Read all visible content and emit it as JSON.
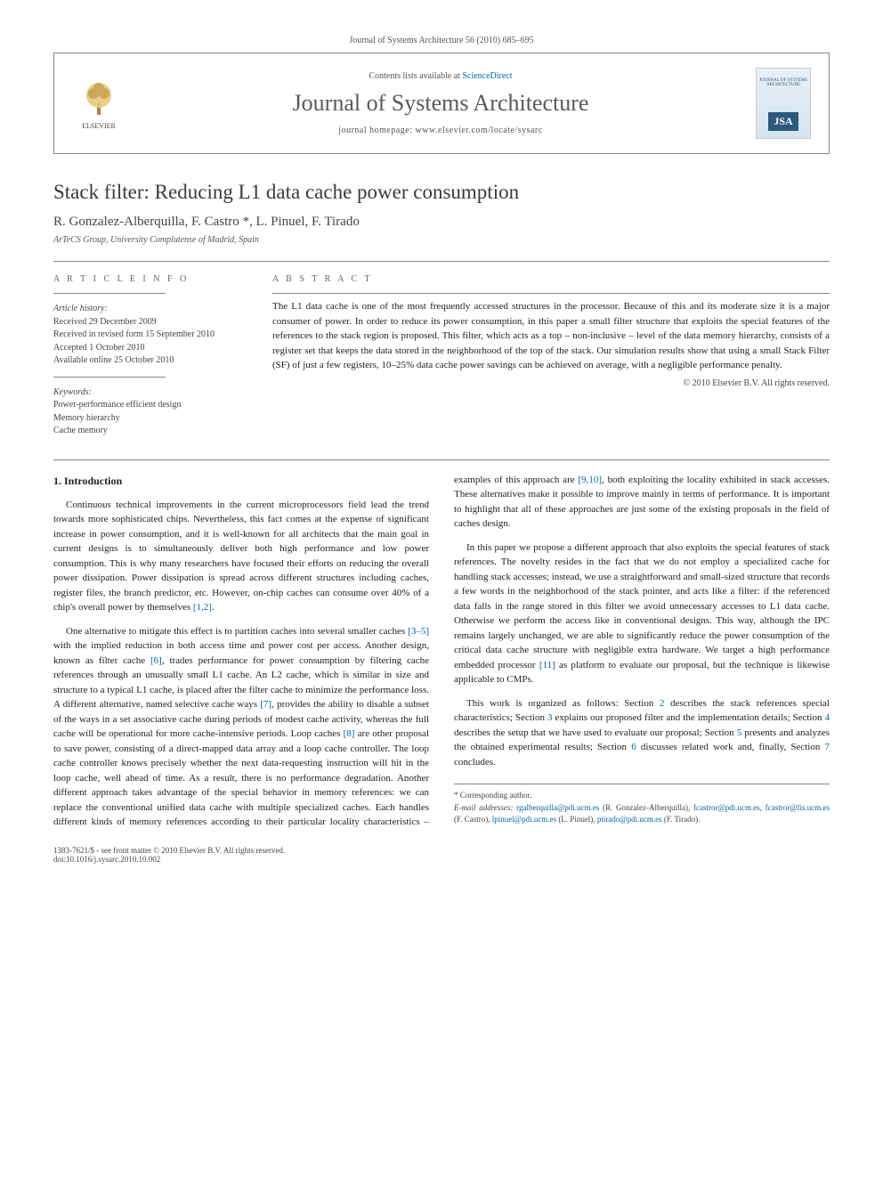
{
  "top_citation": "Journal of Systems Architecture 56 (2010) 685–695",
  "header": {
    "contents_prefix": "Contents lists available at ",
    "contents_link": "ScienceDirect",
    "journal_title": "Journal of Systems Architecture",
    "homepage_prefix": "journal homepage: ",
    "homepage_url": "www.elsevier.com/locate/sysarc",
    "elsevier_label": "ELSEVIER",
    "thumb_top": "JOURNAL OF SYSTEMS ARCHITECTURE",
    "thumb_badge": "JSA"
  },
  "paper": {
    "title": "Stack filter: Reducing L1 data cache power consumption",
    "authors": "R. Gonzalez-Alberquilla, F. Castro *, L. Pinuel, F. Tirado",
    "affiliation": "ArTeCS Group, University Complutense of Madrid, Spain"
  },
  "article_info": {
    "heading": "A R T I C L E   I N F O",
    "history_label": "Article history:",
    "history_lines": [
      "Received 29 December 2009",
      "Received in revised form 15 September 2010",
      "Accepted 1 October 2010",
      "Available online 25 October 2010"
    ],
    "keywords_label": "Keywords:",
    "keywords": [
      "Power-performance efficient design",
      "Memory hierarchy",
      "Cache memory"
    ]
  },
  "abstract": {
    "heading": "A B S T R A C T",
    "text": "The L1 data cache is one of the most frequently accessed structures in the processor. Because of this and its moderate size it is a major consumer of power. In order to reduce its power consumption, in this paper a small filter structure that exploits the special features of the references to the stack region is proposed. This filter, which acts as a top – non-inclusive – level of the data memory hierarchy, consists of a register set that keeps the data stored in the neighborhood of the top of the stack. Our simulation results show that using a small Stack Filter (SF) of just a few registers, 10–25% data cache power savings can be achieved on average, with a negligible performance penalty.",
    "copyright": "© 2010 Elsevier B.V. All rights reserved."
  },
  "sections": {
    "s1_heading": "1. Introduction",
    "p1": "Continuous technical improvements in the current microprocessors field lead the trend towards more sophisticated chips. Nevertheless, this fact comes at the expense of significant increase in power consumption, and it is well-known for all architects that the main goal in current designs is to simultaneously deliver both high performance and low power consumption. This is why many researchers have focused their efforts on reducing the overall power dissipation. Power dissipation is spread across different structures including caches, register files, the branch predictor, etc. However, on-chip caches can consume over 40% of a chip's overall power by themselves ",
    "p1_ref": "[1,2]",
    "p1_tail": ".",
    "p2a": "One alternative to mitigate this effect is to partition caches into several smaller caches ",
    "p2a_ref": "[3–5]",
    "p2b": " with the implied reduction in both access time and power cost per access. Another design, known as filter cache ",
    "p2b_ref": "[6]",
    "p2c": ", trades performance for power consumption by filtering cache references through an unusually small L1 cache. An L2 cache, which is similar in size and structure to a typical L1 cache, is placed after the filter cache to minimize the performance loss. A different alternative, named selective cache ways ",
    "p2c_ref": "[7]",
    "p2d": ", provides the ability to disable a subset of the ways in a set associative cache during periods of modest cache activity, whereas the full cache will be operational for more cache-intensive periods. Loop caches ",
    "p2d_ref": "[8]",
    "p2e": " are other proposal to save power, consisting of a direct-mapped data array and a loop cache controller. The loop cache",
    "p3a": "controller knows precisely whether the next data-requesting instruction will hit in the loop cache, well ahead of time. As a result, there is no performance degradation. Another different approach takes advantage of the special behavior in memory references: we can replace the conventional unified data cache with multiple specialized caches. Each handles different kinds of memory references according to their particular locality characteristics – examples of this approach are ",
    "p3a_ref": "[9,10]",
    "p3b": ", both exploiting the locality exhibited in stack accesses. These alternatives make it possible to improve mainly in terms of performance. It is important to highlight that all of these approaches are just some of the existing proposals in the field of caches design.",
    "p4a": "In this paper we propose a different approach that also exploits the special features of stack references. The novelty resides in the fact that we do not employ a specialized cache for handling stack accesses; instead, we use a straightforward and small-sized structure that records a few words in the neighborhood of the stack pointer, and acts like a filter: if the referenced data falls in the range stored in this filter we avoid unnecessary accesses to L1 data cache. Otherwise we perform the access like in conventional designs. This way, although the IPC remains largely unchanged, we are able to significantly reduce the power consumption of the critical data cache structure with negligible extra hardware. We target a high performance embedded processor ",
    "p4a_ref": "[11]",
    "p4b": " as platform to evaluate our proposal, but the technique is likewise applicable to CMPs.",
    "p5a": "This work is organized as follows: Section ",
    "p5_r2": "2",
    "p5b": " describes the stack references special characteristics; Section ",
    "p5_r3": "3",
    "p5c": " explains our proposed filter and the implementation details; Section ",
    "p5_r4": "4",
    "p5d": " describes the setup that we have used to evaluate our proposal; Section ",
    "p5_r5": "5",
    "p5e": " presents and analyzes the obtained experimental results; Section ",
    "p5_r6": "6",
    "p5f": " discusses related work and, finally, Section ",
    "p5_r7": "7",
    "p5g": " concludes."
  },
  "footnote": {
    "corr": "* Corresponding author.",
    "email_label": "E-mail addresses:",
    "emails": "rgalberquilla@pdi.ucm.es (R. Gonzalez-Alberquilla), fcastror@pdi.ucm.es, fcastror@fis.ucm.es (F. Castro), lpinuel@pdi.ucm.es (L. Pinuel), ptirado@pdi.ucm.es (F. Tirado)."
  },
  "footer": {
    "line1": "1383-7621/$ - see front matter © 2010 Elsevier B.V. All rights reserved.",
    "line2": "doi:10.1016/j.sysarc.2010.10.002"
  }
}
